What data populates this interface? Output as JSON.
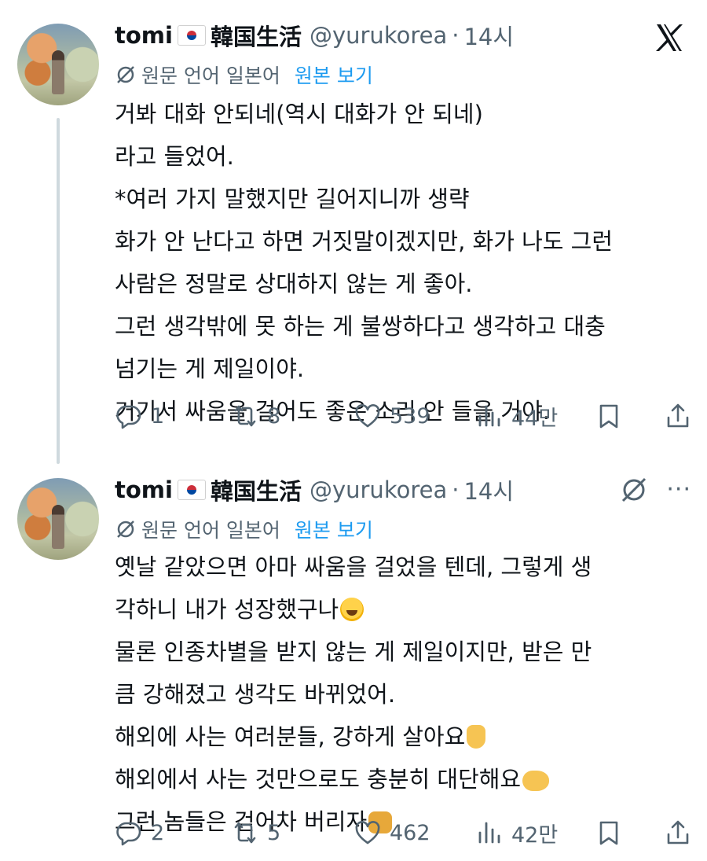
{
  "tweets": [
    {
      "name": "tomi",
      "name_suffix": "韓国生活",
      "handle": "@yurukorea",
      "separator": "·",
      "time": "14시",
      "translate": {
        "lang_label": "원문 언어 일본어",
        "view_label": "원본 보기"
      },
      "lines": [
        "거봐 대화 안되네(역시 대화가 안 되네)",
        "라고 들었어.",
        "*여러 가지 말했지만 길어지니까 생략",
        "화가 안 난다고 하면 거짓말이겠지만, 화가 나도 그런",
        "사람은 정말로 상대하지 않는 게 좋아.",
        "그런 생각밖에 못 하는 게 불쌍하다고 생각하고 대충",
        "넘기는 게 제일이야.",
        "거기서 싸움을 걸어도 좋은 소리 안 들을 거야."
      ],
      "stats": {
        "replies": "1",
        "retweets": "8",
        "likes": "539",
        "views": "44만"
      }
    },
    {
      "name": "tomi",
      "name_suffix": "韓国生活",
      "handle": "@yurukorea",
      "separator": "·",
      "time": "14시",
      "more_label": "···",
      "translate": {
        "lang_label": "원문 언어 일본어",
        "view_label": "원본 보기"
      },
      "lines": [
        "옛날 같았으면 아마 싸움을 걸었을 텐데, 그렇게 생",
        "각하니 내가 성장했구나",
        "물론 인종차별을 받지 않는 게 제일이지만, 받은 만",
        "큼 강해졌고 생각도 바뀌었어.",
        "해외에 사는 여러분들, 강하게 살아요",
        "해외에서 사는 것만으로도 충분히 대단해요",
        "그런 놈들은 걷어차 버리자"
      ],
      "line_emojis": [
        "",
        "face-with-tears-of-joy",
        "",
        "",
        "sign-of-horns",
        "pointing-hand",
        "oncoming-fist"
      ],
      "stats": {
        "replies": "2",
        "retweets": "5",
        "likes": "462",
        "views": "42만"
      }
    }
  ],
  "icons": {
    "close": "x-logo-icon",
    "translate": "translate-slash-icon",
    "reply": "reply-icon",
    "retweet": "retweet-icon",
    "like": "heart-icon",
    "views": "views-bar-chart-icon",
    "bookmark": "bookmark-icon",
    "share": "share-icon",
    "more": "more-dots-icon"
  },
  "colors": {
    "text": "#0f1419",
    "muted": "#536471",
    "link": "#1d9bf0",
    "thread_line": "#cfd9de"
  }
}
